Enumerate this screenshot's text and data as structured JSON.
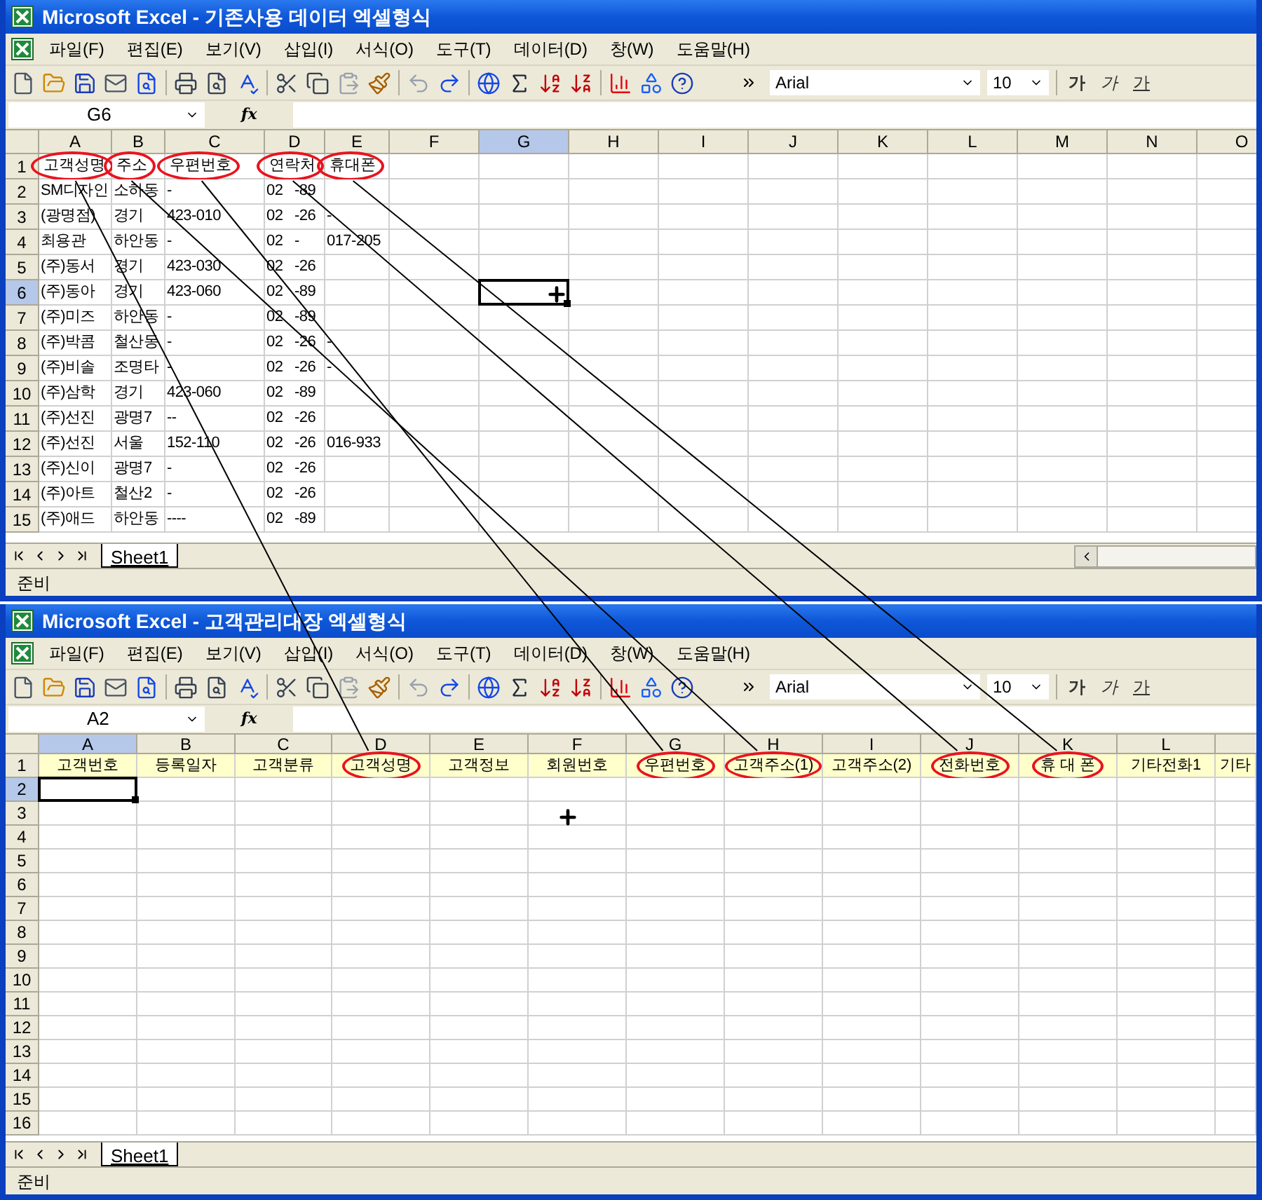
{
  "windows": [
    {
      "title": "Microsoft Excel - 기존사용 데이터 엑셀형식",
      "menu": [
        "파일(F)",
        "편집(E)",
        "보기(V)",
        "삽입(I)",
        "서식(O)",
        "도구(T)",
        "데이터(D)",
        "창(W)",
        "도움말(H)"
      ],
      "font_name": "Arial",
      "font_size": "10",
      "format_buttons": [
        "가",
        "가",
        "가"
      ],
      "name_box": "G6",
      "formula_label": "fx",
      "columns": [
        {
          "letter": "A",
          "selected": false
        },
        {
          "letter": "B",
          "selected": false
        },
        {
          "letter": "C",
          "selected": false
        },
        {
          "letter": "D",
          "selected": false
        },
        {
          "letter": "E",
          "selected": false
        },
        {
          "letter": "F",
          "selected": false
        },
        {
          "letter": "G",
          "selected": true
        },
        {
          "letter": "H",
          "selected": false
        },
        {
          "letter": "I",
          "selected": false
        },
        {
          "letter": "J",
          "selected": false
        },
        {
          "letter": "K",
          "selected": false
        },
        {
          "letter": "L",
          "selected": false
        },
        {
          "letter": "M",
          "selected": false
        },
        {
          "letter": "N",
          "selected": false
        },
        {
          "letter": "O",
          "selected": false
        }
      ],
      "rows": [
        {
          "number": "1",
          "selected": false,
          "shaded": false,
          "cells": [
            {
              "text": "고객성명",
              "circled": true
            },
            {
              "text": "주소",
              "circled": true
            },
            {
              "text": "우편번호",
              "circled": true
            },
            {
              "text": "연락처",
              "circled": true
            },
            {
              "text": "휴대폰",
              "circled": true
            }
          ]
        },
        {
          "number": "2",
          "selected": false,
          "shaded": false,
          "cells": [
            "SM디자인",
            "소하동",
            "-",
            "02 -89",
            ""
          ]
        },
        {
          "number": "3",
          "selected": false,
          "shaded": false,
          "cells": [
            "(광명점)",
            "경기",
            "423-010",
            "02 -26",
            "-"
          ]
        },
        {
          "number": "4",
          "selected": false,
          "shaded": false,
          "cells": [
            "최용관",
            "하안동",
            "-",
            "02 -",
            "017-205"
          ]
        },
        {
          "number": "5",
          "selected": false,
          "shaded": false,
          "cells": [
            "(주)동서",
            "경기",
            "423-030",
            "02 -26",
            ""
          ]
        },
        {
          "number": "6",
          "selected": true,
          "shaded": false,
          "cells": [
            "(주)동아",
            "경기",
            "423-060",
            "02 -89",
            ""
          ]
        },
        {
          "number": "7",
          "selected": false,
          "shaded": false,
          "cells": [
            "(주)미즈",
            "하안동",
            "-",
            "02 -89",
            ""
          ]
        },
        {
          "number": "8",
          "selected": false,
          "shaded": false,
          "cells": [
            "(주)박콤",
            "철산동",
            "-",
            "02 -26",
            "-"
          ]
        },
        {
          "number": "9",
          "selected": false,
          "shaded": false,
          "cells": [
            "(주)비솔",
            "조명타",
            "-",
            "02 -26",
            "-"
          ]
        },
        {
          "number": "10",
          "selected": false,
          "shaded": false,
          "cells": [
            "(주)삼학",
            "경기",
            "423-060",
            "02 -89",
            ""
          ]
        },
        {
          "number": "11",
          "selected": false,
          "shaded": false,
          "cells": [
            "(주)선진",
            "광명7",
            "--",
            "02 -26",
            ""
          ]
        },
        {
          "number": "12",
          "selected": false,
          "shaded": false,
          "cells": [
            "(주)선진",
            "서울",
            "152-110",
            "02 -26",
            "016-933"
          ]
        },
        {
          "number": "13",
          "selected": false,
          "shaded": false,
          "cells": [
            "(주)신이",
            "광명7",
            "-",
            "02 -26",
            ""
          ]
        },
        {
          "number": "14",
          "selected": false,
          "shaded": false,
          "cells": [
            "(주)아트",
            "철산2",
            "-",
            "02 -26",
            ""
          ]
        },
        {
          "number": "15",
          "selected": false,
          "shaded": false,
          "cells": [
            "(주)애드",
            "하안동",
            "----",
            "02 -89",
            ""
          ]
        }
      ],
      "sheet_tabs": [
        {
          "label": "Sheet1",
          "selected": true
        }
      ],
      "horizontal_scrollbar": true,
      "status": "준비"
    },
    {
      "title": "Microsoft Excel - 고객관리대장 엑셀형식",
      "menu": [
        "파일(F)",
        "편집(E)",
        "보기(V)",
        "삽입(I)",
        "서식(O)",
        "도구(T)",
        "데이터(D)",
        "창(W)",
        "도움말(H)"
      ],
      "font_name": "Arial",
      "font_size": "10",
      "format_buttons": [
        "가",
        "가",
        "가"
      ],
      "name_box": "A2",
      "formula_label": "fx",
      "columns": [
        {
          "letter": "A",
          "selected": true
        },
        {
          "letter": "B",
          "selected": false
        },
        {
          "letter": "C",
          "selected": false
        },
        {
          "letter": "D",
          "selected": false
        },
        {
          "letter": "E",
          "selected": false
        },
        {
          "letter": "F",
          "selected": false
        },
        {
          "letter": "G",
          "selected": false
        },
        {
          "letter": "H",
          "selected": false
        },
        {
          "letter": "I",
          "selected": false
        },
        {
          "letter": "J",
          "selected": false
        },
        {
          "letter": "K",
          "selected": false
        },
        {
          "letter": "L",
          "selected": false
        }
      ],
      "rows": [
        {
          "number": "1",
          "selected": false,
          "shaded": true,
          "cells": [
            {
              "text": "고객번호",
              "circled": false
            },
            {
              "text": "등록일자",
              "circled": false
            },
            {
              "text": "고객분류",
              "circled": false
            },
            {
              "text": "고객성명",
              "circled": true
            },
            {
              "text": "고객정보",
              "circled": false
            },
            {
              "text": "회원번호",
              "circled": false
            },
            {
              "text": "우편번호",
              "circled": true
            },
            {
              "text": "고객주소(1)",
              "circled": true
            },
            {
              "text": "고객주소(2)",
              "circled": false
            },
            {
              "text": "전화번호",
              "circled": true
            },
            {
              "text": "휴 대 폰",
              "circled": true
            },
            {
              "text": "기타전화1",
              "circled": false
            },
            {
              "text": "기타",
              "circled": false
            }
          ]
        },
        {
          "number": "2",
          "selected": true,
          "shaded": false
        },
        {
          "number": "3",
          "selected": false,
          "shaded": false
        },
        {
          "number": "4",
          "selected": false,
          "shaded": false
        },
        {
          "number": "5",
          "selected": false,
          "shaded": false
        },
        {
          "number": "6",
          "selected": false,
          "shaded": false
        },
        {
          "number": "7",
          "selected": false,
          "shaded": false
        },
        {
          "number": "8",
          "selected": false,
          "shaded": false
        },
        {
          "number": "9",
          "selected": false,
          "shaded": false
        },
        {
          "number": "10",
          "selected": false,
          "shaded": false
        },
        {
          "number": "11",
          "selected": false,
          "shaded": false
        },
        {
          "number": "12",
          "selected": false,
          "shaded": false
        },
        {
          "number": "13",
          "selected": false,
          "shaded": false
        },
        {
          "number": "14",
          "selected": false,
          "shaded": false
        },
        {
          "number": "15",
          "selected": false,
          "shaded": false
        },
        {
          "number": "16",
          "selected": false,
          "shaded": false
        }
      ],
      "sheet_tabs": [
        {
          "label": "Sheet1",
          "selected": true
        }
      ],
      "horizontal_scrollbar": false,
      "status": "준비"
    }
  ]
}
